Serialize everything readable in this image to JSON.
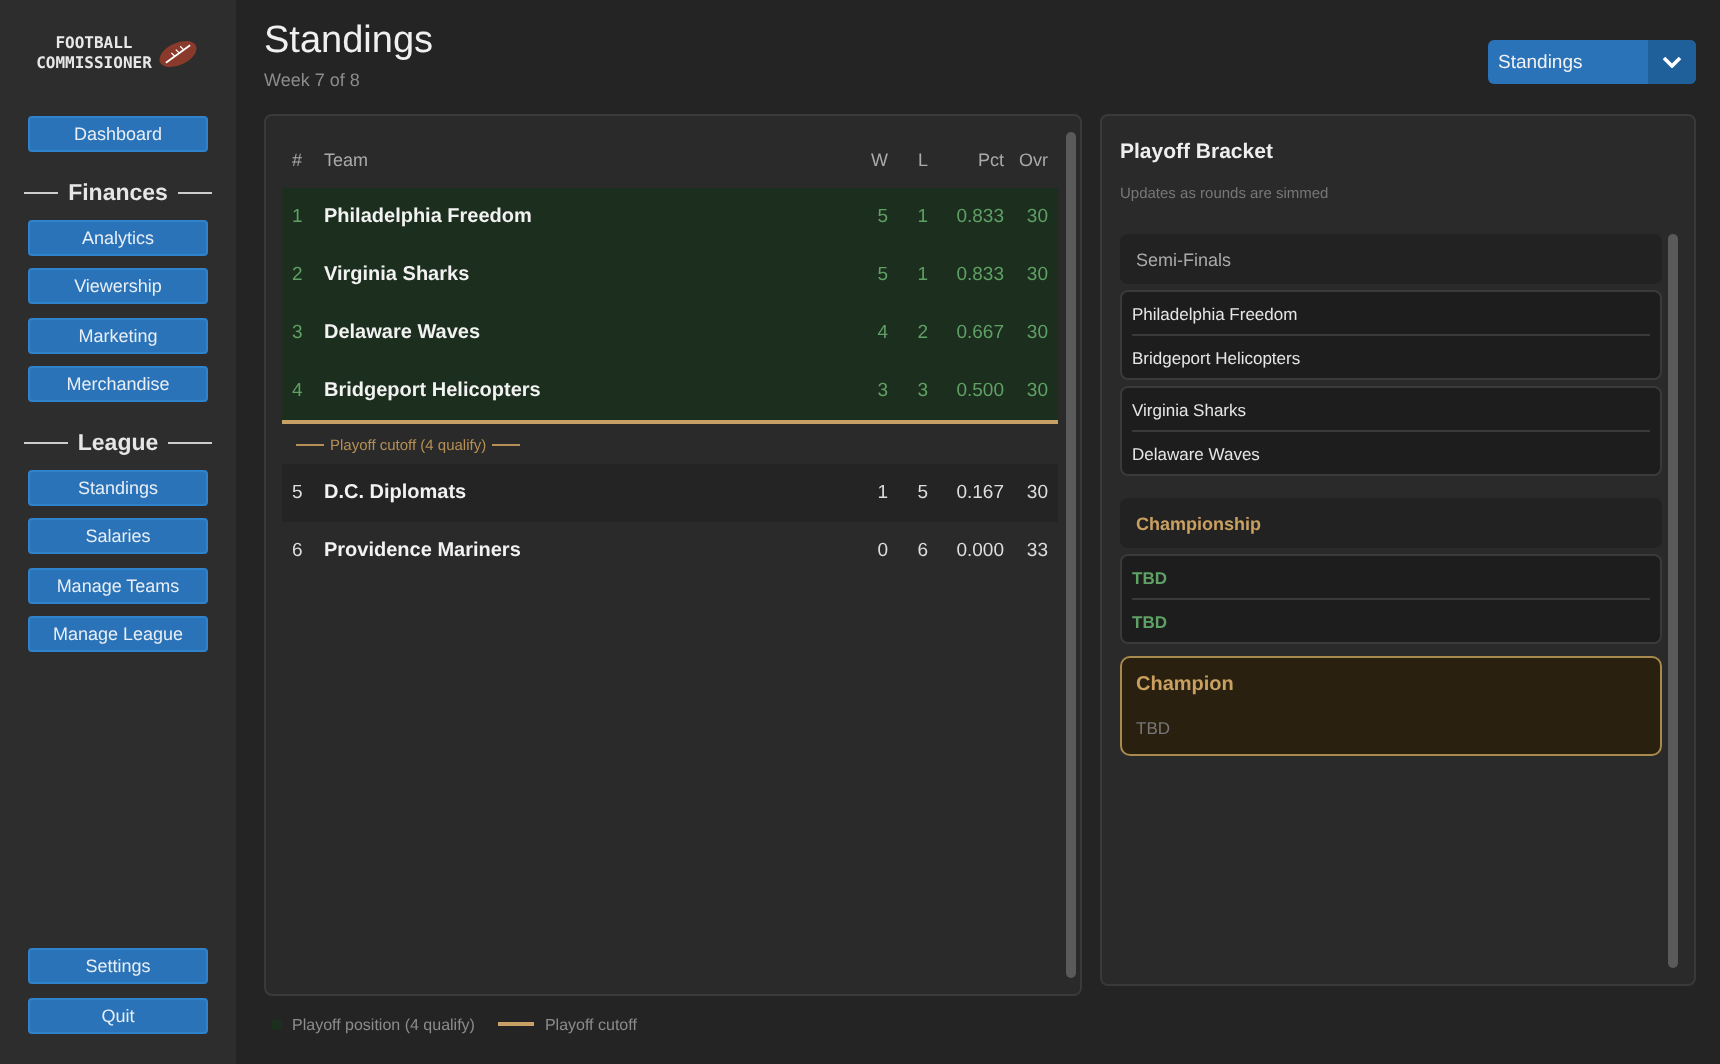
{
  "logo": {
    "line1": "FOOTBALL",
    "line2": "COMMISSIONER"
  },
  "sidebar": {
    "top": [
      {
        "label": "Dashboard"
      }
    ],
    "sections": [
      {
        "heading": "Finances",
        "items": [
          {
            "label": "Analytics"
          },
          {
            "label": "Viewership"
          },
          {
            "label": "Marketing"
          },
          {
            "label": "Merchandise"
          }
        ]
      },
      {
        "heading": "League",
        "items": [
          {
            "label": "Standings"
          },
          {
            "label": "Salaries"
          },
          {
            "label": "Manage Teams"
          },
          {
            "label": "Manage League"
          }
        ]
      }
    ],
    "bottom": [
      {
        "label": "Settings"
      },
      {
        "label": "Quit"
      }
    ]
  },
  "header": {
    "title": "Standings",
    "subtitle": "Week 7 of 8",
    "view_select": {
      "value": "Standings"
    }
  },
  "table": {
    "columns": [
      "#",
      "Team",
      "W",
      "L",
      "Pct",
      "Ovr"
    ],
    "rows": [
      {
        "cells": [
          "1",
          "Philadelphia Freedom",
          "5",
          "1",
          "0.833",
          "30"
        ],
        "playoff": true
      },
      {
        "cells": [
          "2",
          "Virginia Sharks",
          "5",
          "1",
          "0.833",
          "30"
        ],
        "playoff": true
      },
      {
        "cells": [
          "3",
          "Delaware Waves",
          "4",
          "2",
          "0.667",
          "30"
        ],
        "playoff": true
      },
      {
        "cells": [
          "4",
          "Bridgeport Helicopters",
          "3",
          "3",
          "0.500",
          "30"
        ],
        "playoff": true
      },
      {
        "cells": [
          "5",
          "D.C. Diplomats",
          "1",
          "5",
          "0.167",
          "30"
        ],
        "playoff": false
      },
      {
        "cells": [
          "6",
          "Providence Mariners",
          "0",
          "6",
          "0.000",
          "33"
        ],
        "playoff": false
      }
    ],
    "cutoff_label": "Playoff cutoff  (4 qualify)"
  },
  "legend": [
    {
      "kind": "swatch",
      "label": "Playoff position  (4 qualify)"
    },
    {
      "kind": "line",
      "label": "Playoff cutoff"
    }
  ],
  "bracket": {
    "title": "Playoff Bracket",
    "subtitle": "Updates as rounds are simmed",
    "rounds": [
      {
        "kind": "semi",
        "label": "Semi-Finals",
        "matchups": [
          [
            "Philadelphia Freedom",
            "Bridgeport Helicopters"
          ],
          [
            "Virginia Sharks",
            "Delaware Waves"
          ]
        ]
      },
      {
        "kind": "final",
        "label": "Championship",
        "matchups": [
          [
            "TBD",
            "TBD"
          ]
        ]
      }
    ],
    "champion": {
      "label": "Champion",
      "team": "TBD"
    }
  }
}
